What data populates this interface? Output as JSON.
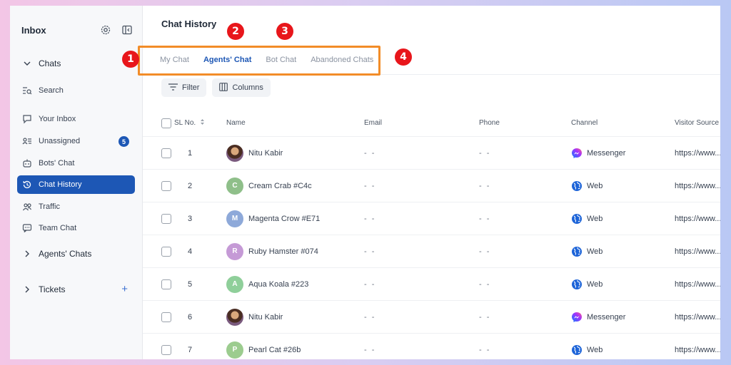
{
  "sidebar": {
    "title": "Inbox",
    "items": [
      {
        "label": "Chats",
        "icon": "chevron-down-icon"
      },
      {
        "label": "Search",
        "icon": "search-list-icon"
      },
      {
        "label": "Your Inbox",
        "icon": "chat-bubble-icon"
      },
      {
        "label": "Unassigned",
        "icon": "user-list-icon",
        "badge": "5"
      },
      {
        "label": "Bots' Chat",
        "icon": "robot-icon"
      },
      {
        "label": "Chat History",
        "icon": "history-icon"
      },
      {
        "label": "Traffic",
        "icon": "users-icon"
      },
      {
        "label": "Team Chat",
        "icon": "team-chat-icon"
      },
      {
        "label": "Agents' Chats",
        "icon": "chevron-right-icon"
      },
      {
        "label": "Tickets",
        "icon": "chevron-right-icon"
      }
    ],
    "tickets_add": "+"
  },
  "main": {
    "title": "Chat History",
    "tabs": [
      {
        "label": "My Chat"
      },
      {
        "label": "Agents' Chat"
      },
      {
        "label": "Bot Chat"
      },
      {
        "label": "Abandoned Chats"
      }
    ],
    "toolbar": {
      "filter": "Filter",
      "columns": "Columns"
    },
    "table": {
      "headers": {
        "sl": "SL No.",
        "name": "Name",
        "email": "Email",
        "phone": "Phone",
        "channel": "Channel",
        "visitor_source": "Visitor Source"
      },
      "rows": [
        {
          "sl": "1",
          "name": "Nitu Kabir",
          "initial": "",
          "email": "- -",
          "phone": "- -",
          "channel": "Messenger",
          "source": "https://www..."
        },
        {
          "sl": "2",
          "name": "Cream Crab #C4c",
          "initial": "C",
          "email": "- -",
          "phone": "- -",
          "channel": "Web",
          "source": "https://www..."
        },
        {
          "sl": "3",
          "name": "Magenta Crow #E71",
          "initial": "M",
          "email": "- -",
          "phone": "- -",
          "channel": "Web",
          "source": "https://www..."
        },
        {
          "sl": "4",
          "name": "Ruby Hamster #074",
          "initial": "R",
          "email": "- -",
          "phone": "- -",
          "channel": "Web",
          "source": "https://www..."
        },
        {
          "sl": "5",
          "name": "Aqua Koala #223",
          "initial": "A",
          "email": "- -",
          "phone": "- -",
          "channel": "Web",
          "source": "https://www..."
        },
        {
          "sl": "6",
          "name": "Nitu Kabir",
          "initial": "",
          "email": "- -",
          "phone": "- -",
          "channel": "Messenger",
          "source": "https://www..."
        },
        {
          "sl": "7",
          "name": "Pearl Cat #26b",
          "initial": "P",
          "email": "- -",
          "phone": "- -",
          "channel": "Web",
          "source": "https://www..."
        }
      ]
    }
  },
  "markers": [
    "1",
    "2",
    "3",
    "4"
  ],
  "colors": {
    "accent": "#1d57b5",
    "highlight": "#f28c28",
    "marker": "#e8161b"
  }
}
